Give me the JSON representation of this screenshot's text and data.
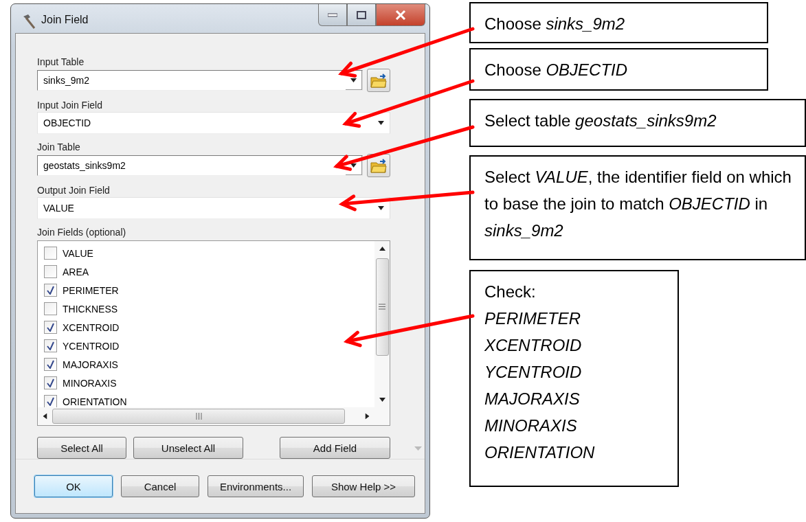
{
  "window": {
    "title": "Join Field"
  },
  "fields": [
    {
      "label": "Input Table",
      "value": "sinks_9m2",
      "kind": "combo"
    },
    {
      "label": "Input Join Field",
      "value": "OBJECTID",
      "kind": "dropdown"
    },
    {
      "label": "Join Table",
      "value": "geostats_sinks9m2",
      "kind": "combo"
    },
    {
      "label": "Output Join Field",
      "value": "VALUE",
      "kind": "dropdown"
    }
  ],
  "join_fields": {
    "label": "Join Fields (optional)",
    "items": [
      {
        "name": "VALUE",
        "checked": false
      },
      {
        "name": "AREA",
        "checked": false
      },
      {
        "name": "PERIMETER",
        "checked": true
      },
      {
        "name": "THICKNESS",
        "checked": false
      },
      {
        "name": "XCENTROID",
        "checked": true
      },
      {
        "name": "YCENTROID",
        "checked": true
      },
      {
        "name": "MAJORAXIS",
        "checked": true
      },
      {
        "name": "MINORAXIS",
        "checked": true
      },
      {
        "name": "ORIENTATION",
        "checked": true
      }
    ]
  },
  "list_buttons": [
    "Select All",
    "Unselect All",
    "Add Field"
  ],
  "footer_buttons": [
    {
      "label": "OK",
      "default": true
    },
    {
      "label": "Cancel",
      "default": false
    },
    {
      "label": "Environments...",
      "default": false
    },
    {
      "label": "Show Help >>",
      "default": false
    }
  ],
  "callouts": [
    {
      "text": "Choose *sinks_9m2*"
    },
    {
      "text": "Choose *OBJECTID*"
    },
    {
      "text": "Select table *geostats_sinks9m2*"
    },
    {
      "text": "Select *VALUE*, the identifier field on which to base the join to match *OBJECTID* in *sinks_9m2*"
    },
    {
      "text": "Check: *PERIMETER* *XCENTROID* *YCENTROID* *MAJORAXIS* *MINORAXIS* *ORIENTATION*",
      "kind": "list"
    }
  ]
}
